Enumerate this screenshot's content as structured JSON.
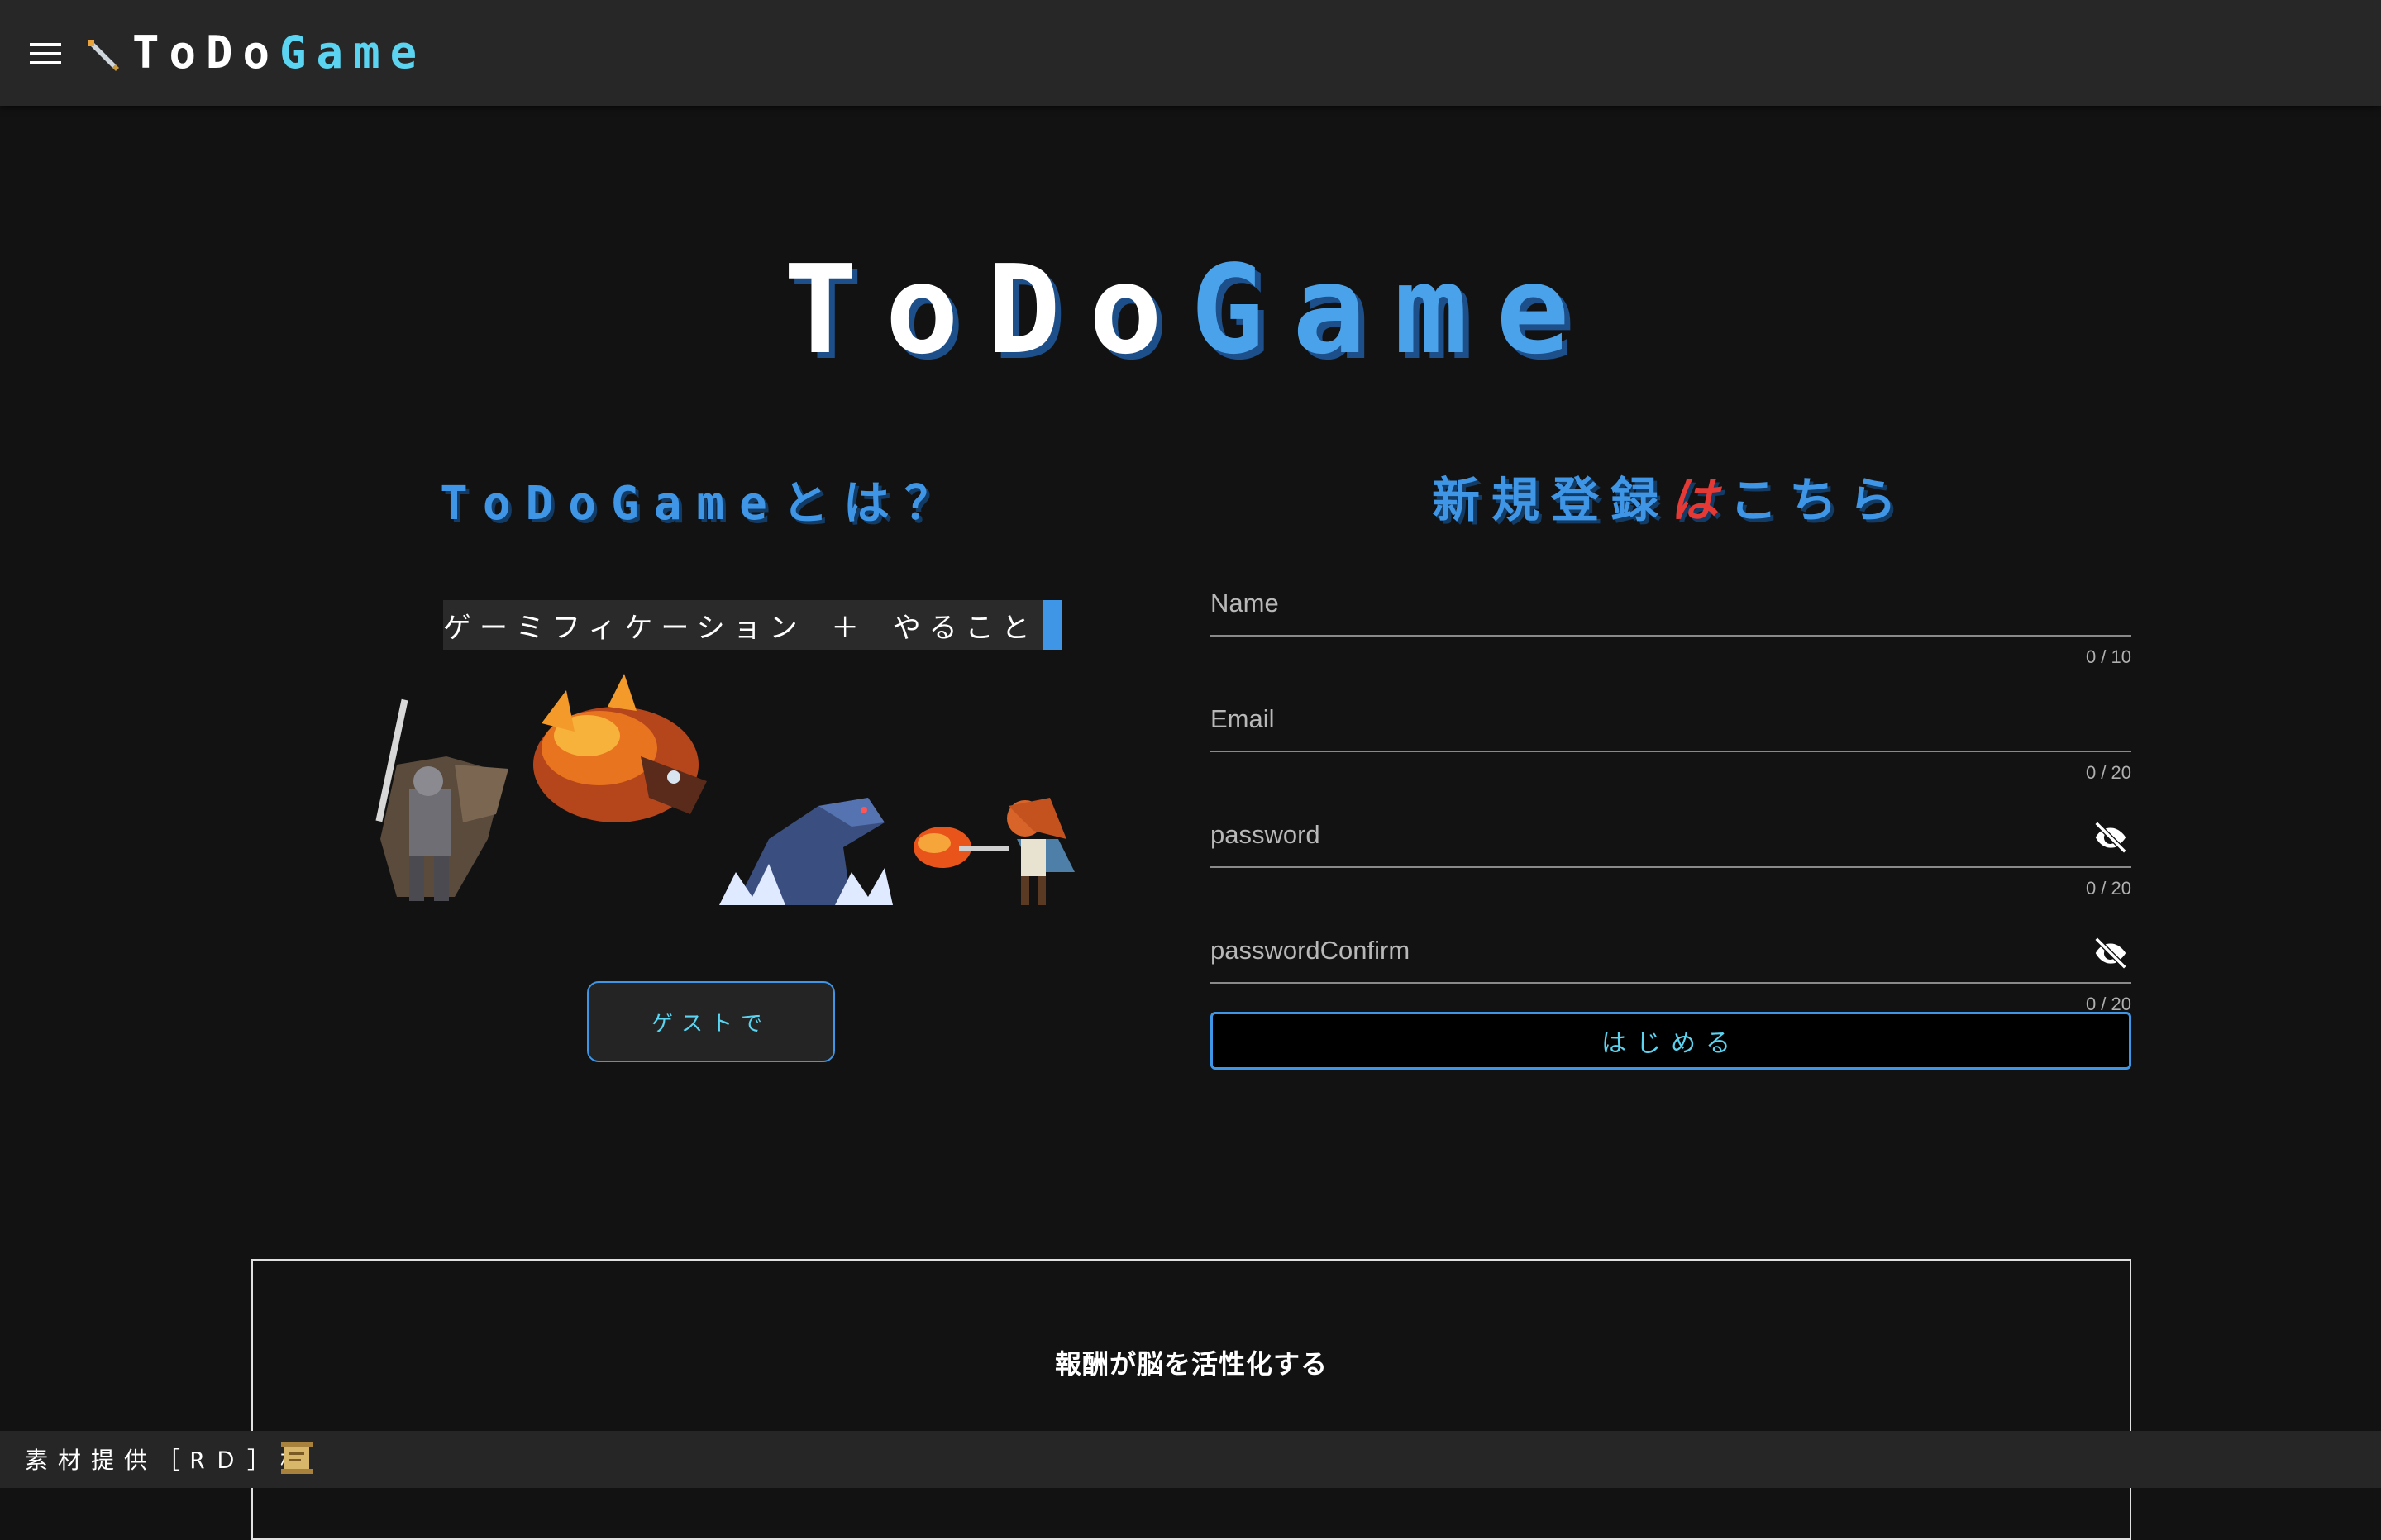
{
  "appbar": {
    "logo_part1": "ToDo",
    "logo_part2": "Game",
    "menu_icon": "hamburger-menu-icon",
    "logo_icon": "sword-icon"
  },
  "hero": {
    "title_part1": "ToDo",
    "title_part2": "Game"
  },
  "about": {
    "title": "ToDoGameとは？",
    "typed_text": "ゲーミフィケーション ＋ やること",
    "sprites": [
      "knight-sprite",
      "fire-dragon-sprite",
      "water-serpent-sprite",
      "fire-mage-girl-sprite"
    ],
    "guest_button": "ゲストで"
  },
  "signup": {
    "title_part1": "新規登録",
    "title_part2": "は",
    "title_part3": "こちら",
    "fields": [
      {
        "placeholder": "Name",
        "value": "",
        "counter": "0 / 10"
      },
      {
        "placeholder": "Email",
        "value": "",
        "counter": "0 / 20"
      },
      {
        "placeholder": "password",
        "value": "",
        "counter": "0 / 20",
        "icon": "eye-off-icon"
      },
      {
        "placeholder": "passwordConfirm",
        "value": "",
        "counter": "0 / 20",
        "icon": "eye-off-icon"
      }
    ],
    "submit_label": "はじめる"
  },
  "info_box": {
    "text": "報酬が脳を活性化する"
  },
  "footer": {
    "credit": "素材提供［RＤ］様",
    "icon": "scroll-icon"
  },
  "colors": {
    "accent_blue": "#3f96e6",
    "accent_cyan": "#5ad4f0",
    "accent_red": "#e53935",
    "background": "#121212",
    "appbar": "#272727"
  }
}
